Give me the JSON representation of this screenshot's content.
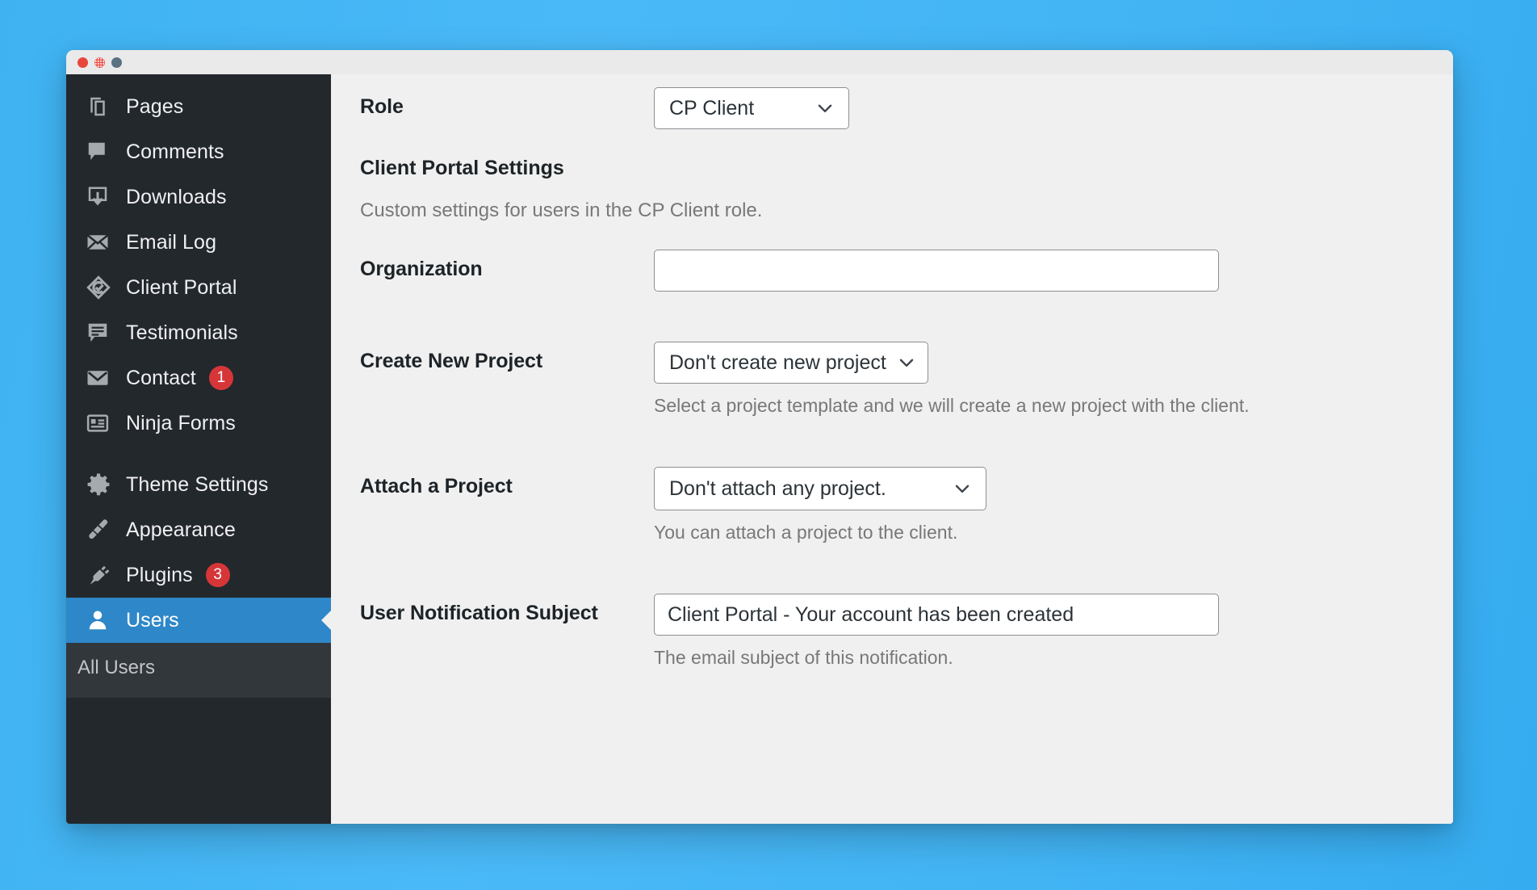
{
  "window": {
    "traffic_lights": [
      "close-button",
      "minimize-button",
      "zoom-button"
    ]
  },
  "sidebar": {
    "items": [
      {
        "label": "Pages",
        "icon": "pages-icon",
        "badge": null,
        "active": false
      },
      {
        "label": "Comments",
        "icon": "comments-icon",
        "badge": null,
        "active": false
      },
      {
        "label": "Downloads",
        "icon": "downloads-icon",
        "badge": null,
        "active": false
      },
      {
        "label": "Email Log",
        "icon": "envelope-open-icon",
        "badge": null,
        "active": false
      },
      {
        "label": "Client Portal",
        "icon": "client-portal-icon",
        "badge": null,
        "active": false
      },
      {
        "label": "Testimonials",
        "icon": "testimonials-icon",
        "badge": null,
        "active": false
      },
      {
        "label": "Contact",
        "icon": "mail-icon",
        "badge": "1",
        "active": false
      },
      {
        "label": "Ninja Forms",
        "icon": "ninja-forms-icon",
        "badge": null,
        "active": false
      },
      {
        "label": "Theme Settings",
        "icon": "gear-icon",
        "badge": null,
        "active": false
      },
      {
        "label": "Appearance",
        "icon": "paintbrush-icon",
        "badge": null,
        "active": false
      },
      {
        "label": "Plugins",
        "icon": "plug-icon",
        "badge": "3",
        "active": false
      },
      {
        "label": "Users",
        "icon": "user-icon",
        "badge": null,
        "active": true
      }
    ],
    "submenu": [
      {
        "label": "All Users"
      }
    ],
    "colors": {
      "background": "#23282d",
      "submenu_background": "#32373c",
      "active_background": "#2e87c8",
      "badge_background": "#d63638"
    }
  },
  "main": {
    "role_row": {
      "label": "Role",
      "select_value": "CP Client"
    },
    "section": {
      "title": "Client Portal Settings",
      "description": "Custom settings for users in the CP Client role."
    },
    "organization_row": {
      "label": "Organization",
      "value": "",
      "placeholder": ""
    },
    "create_project_row": {
      "label": "Create New Project",
      "select_value": "Don't create new project",
      "help": "Select a project template and we will create a new project with the client."
    },
    "attach_project_row": {
      "label": "Attach a Project",
      "select_value": "Don't attach any project.",
      "help": "You can attach a project to the client."
    },
    "notification_subject_row": {
      "label": "User Notification Subject",
      "value": "Client Portal - Your account has been created",
      "help": "The email subject of this notification."
    }
  }
}
